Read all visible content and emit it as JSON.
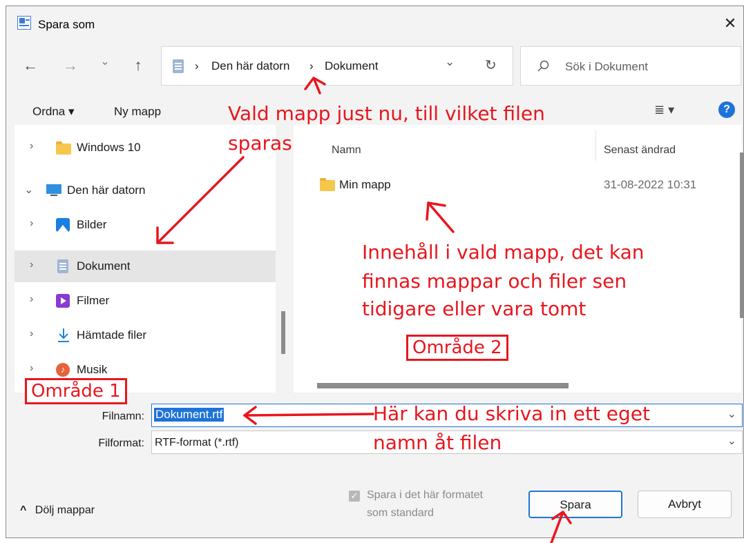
{
  "dialog": {
    "title": "Spara som",
    "close_glyph": "✕",
    "nav": {
      "back": "←",
      "forward": "→",
      "recent": "⌄",
      "up": "↑"
    },
    "address": {
      "crumbs": [
        "Den här datorn",
        "Dokument"
      ],
      "sep": "›",
      "dropdown": "⌄",
      "refresh": "↻"
    },
    "search": {
      "placeholder": "Sök i Dokument",
      "icon": "search-icon"
    },
    "toolbar": {
      "organize": "Ordna ▾",
      "new_folder": "Ny mapp",
      "view": "≣ ▾",
      "help": "?"
    },
    "sidebar": {
      "items": [
        {
          "label": "Windows 10",
          "icon": "folder-icon",
          "expanded": false
        },
        {
          "label": "Den här datorn",
          "icon": "computer-icon",
          "expanded": true
        },
        {
          "label": "Bilder",
          "icon": "pictures-icon"
        },
        {
          "label": "Dokument",
          "icon": "document-icon",
          "selected": true
        },
        {
          "label": "Filmer",
          "icon": "video-icon"
        },
        {
          "label": "Hämtade filer",
          "icon": "download-icon"
        },
        {
          "label": "Musik",
          "icon": "music-icon"
        }
      ],
      "expand_glyph": "›",
      "collapse_glyph": "⌄"
    },
    "filelist": {
      "columns": {
        "name": "Namn",
        "modified": "Senast ändrad"
      },
      "rows": [
        {
          "name": "Min mapp",
          "modified": "31-08-2022 10:31",
          "icon": "folder-icon"
        }
      ]
    },
    "filename": {
      "label": "Filnamn:",
      "value": "Dokument.rtf"
    },
    "filetype": {
      "label": "Filformat:",
      "value": "RTF-format (*.rtf)"
    },
    "default_checkbox": {
      "line1": "Spara i det här formatet",
      "line2": "som standard",
      "checked": true
    },
    "hide_folders": "Dölj mappar",
    "hide_glyph": "^",
    "save_label": "Spara",
    "cancel_label": "Avbryt"
  },
  "annotations": {
    "top_line1": "Vald mapp just nu, till vilket filen",
    "top_line2": "sparas",
    "content_line1": "Innehåll i vald mapp, det kan",
    "content_line2": "finnas mappar och filer sen",
    "content_line3": "tidigare eller vara tomt",
    "area2": "Område 2",
    "area1": "Område 1",
    "filename_line1": "Här kan du skriva in ett eget",
    "filename_line2": "namn åt filen",
    "color": "#e8161e"
  }
}
